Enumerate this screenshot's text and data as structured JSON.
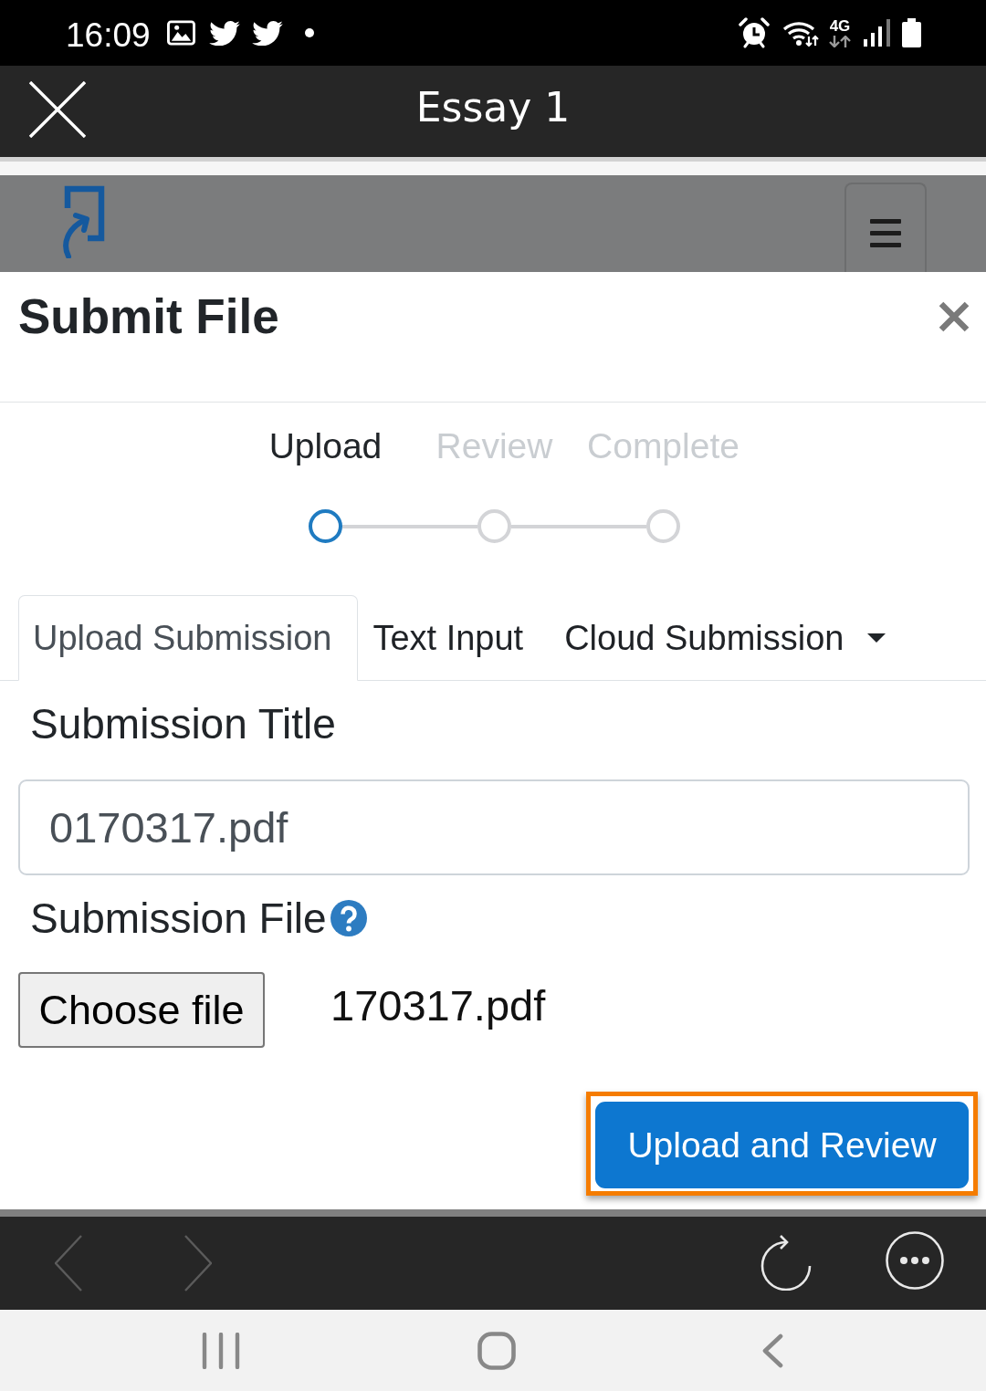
{
  "status_bar": {
    "time": "16:09",
    "network": "4G"
  },
  "app_bar": {
    "title": "Essay 1"
  },
  "dialog": {
    "title": "Submit File",
    "steps": [
      {
        "label": "Upload",
        "selected": true
      },
      {
        "label": "Review",
        "selected": false
      },
      {
        "label": "Complete",
        "selected": false
      }
    ],
    "tabs": [
      {
        "label": "Upload Submission",
        "selected": true,
        "dropdown": false
      },
      {
        "label": "Text Input",
        "selected": false,
        "dropdown": false
      },
      {
        "label": "Cloud Submission",
        "selected": false,
        "dropdown": true
      }
    ],
    "fields": [
      {
        "kind": "text",
        "label": "Submission Title",
        "value": "0170317.pdf"
      },
      {
        "kind": "file",
        "label": "Submission File",
        "help": true,
        "button": "Choose file",
        "file_name": "170317.pdf"
      }
    ],
    "primary_button": {
      "label": "Upload and Review",
      "highlighted": true
    }
  },
  "browser_toolbar": {
    "back_disabled": true,
    "forward_disabled": true
  }
}
